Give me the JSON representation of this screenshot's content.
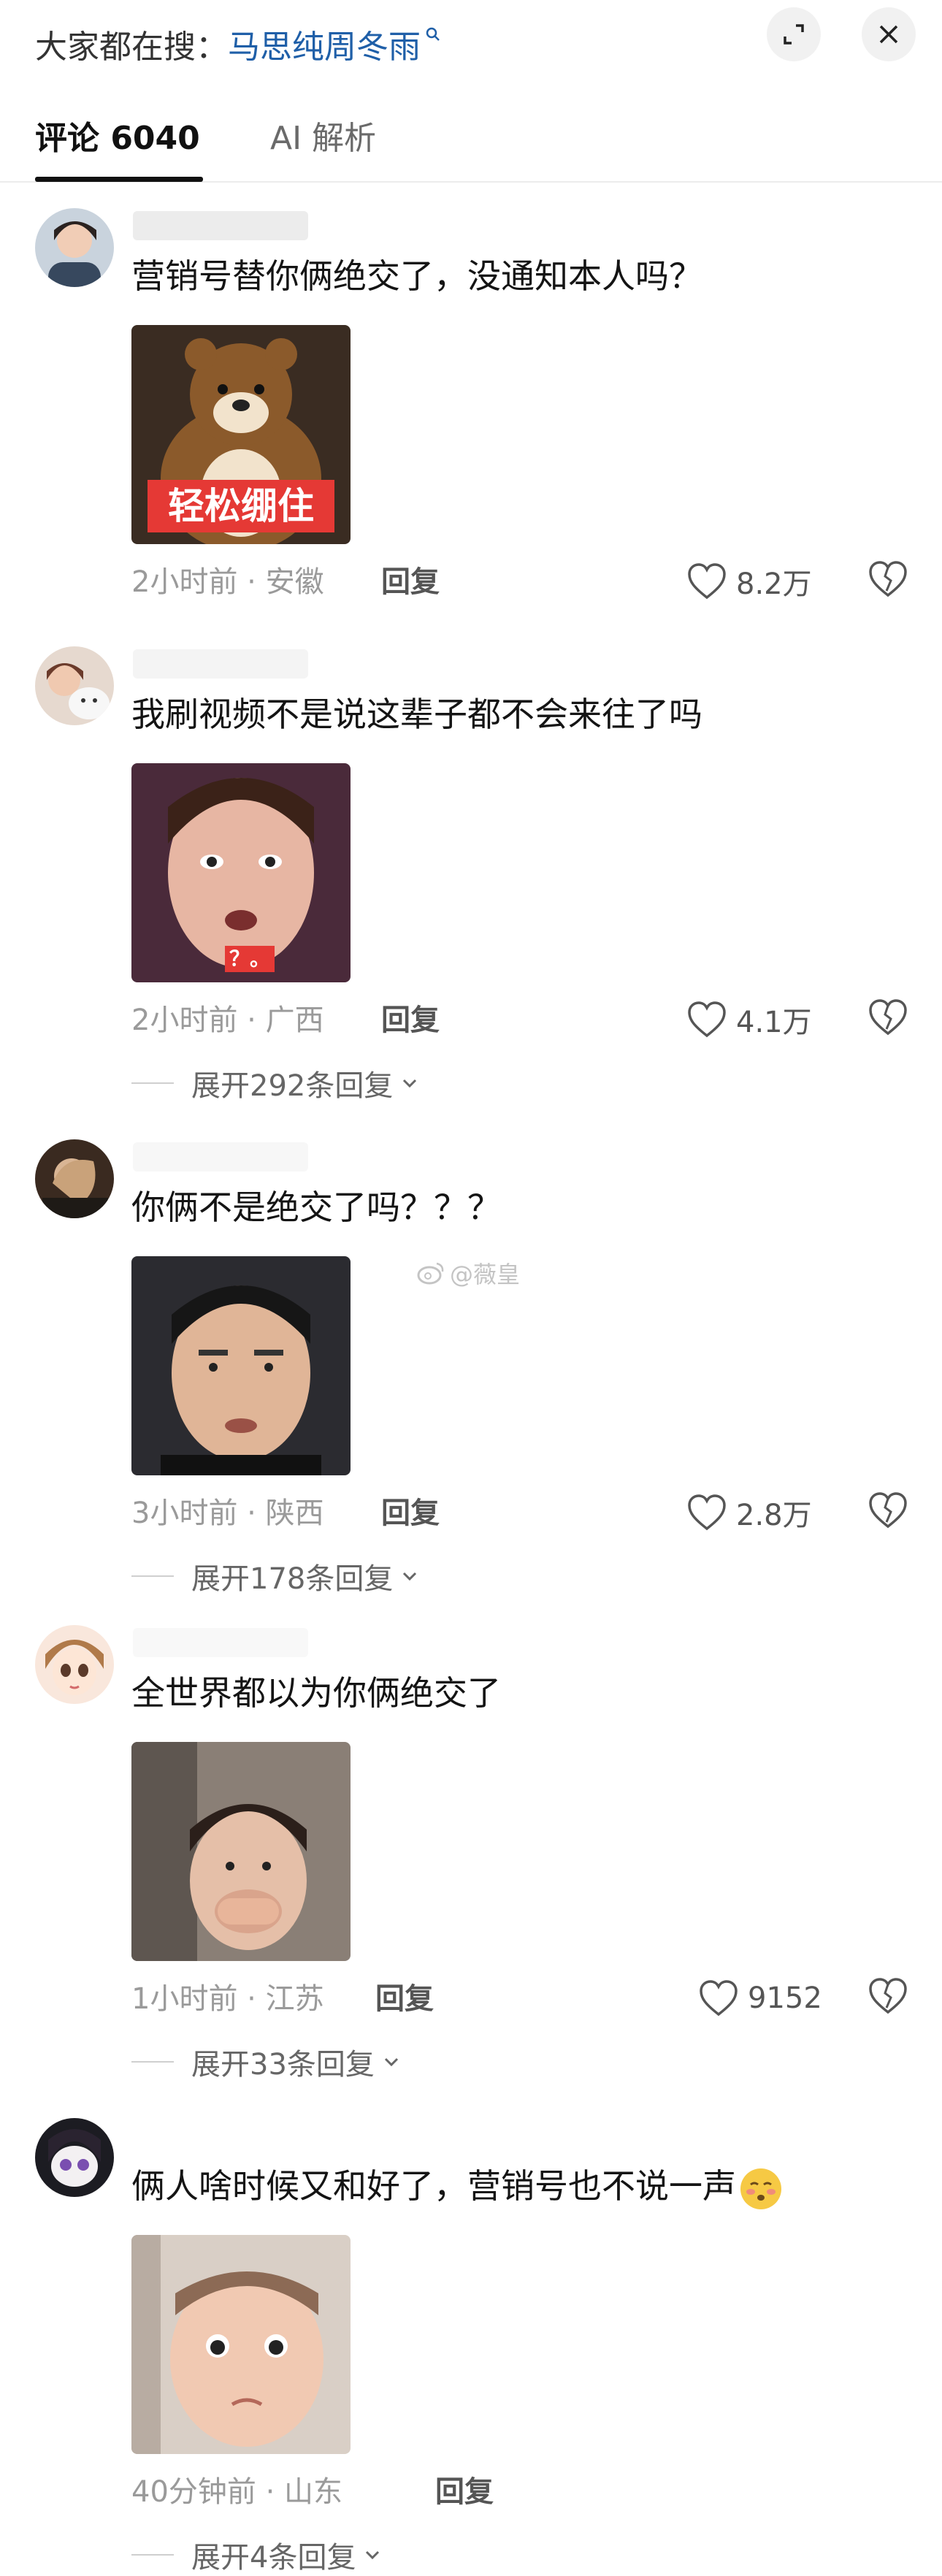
{
  "header": {
    "search_prefix": "大家都在搜：",
    "search_term": "马思纯周冬雨"
  },
  "tabs": {
    "comments_label": "评论 6040",
    "ai_label": "AI 解析"
  },
  "reply_label": "回复",
  "watermark": "@薇皇",
  "comments": [
    {
      "text": "营销号替你俩绝交了，没通知本人吗？",
      "image_caption": "轻松绷住",
      "meta": "2小时前 · 安徽",
      "likes": "8.2万"
    },
    {
      "text": "我刷视频不是说这辈子都不会来往了吗",
      "image_caption": "？。",
      "meta": "2小时前 · 广西",
      "likes": "4.1万",
      "expand": "展开292条回复"
    },
    {
      "text": "你俩不是绝交了吗？？？",
      "meta": "3小时前 · 陕西",
      "likes": "2.8万",
      "expand": "展开178条回复"
    },
    {
      "text": "全世界都以为你俩绝交了",
      "meta": "1小时前 · 江苏",
      "likes": "9152",
      "expand": "展开33条回复"
    },
    {
      "text": "俩人啥时候又和好了，营销号也不说一声",
      "meta": "40分钟前 · 山东",
      "expand": "展开4条回复"
    }
  ],
  "colors": {
    "search_term": "#1f5fa8",
    "caption_bg": "#e53935"
  }
}
